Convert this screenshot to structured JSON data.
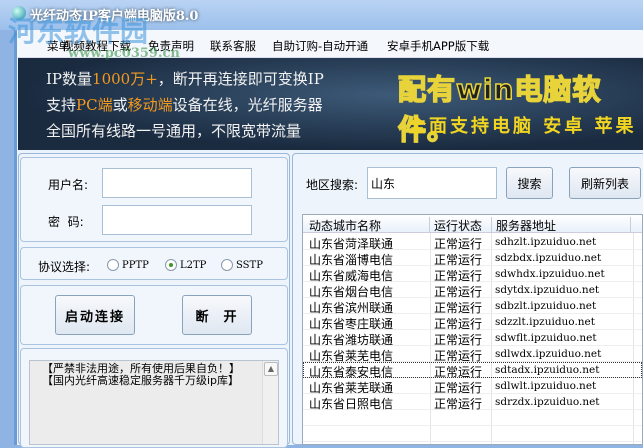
{
  "window": {
    "title": "光纤动态IP客户端电脑版8.0"
  },
  "watermark": {
    "name": "河东软件园",
    "url": "www.pc0359.cn"
  },
  "menu": [
    "菜单",
    "视频教程下载",
    "免责声明",
    "联系客服",
    "自助订购-自动开通",
    "安卓手机APP版下载"
  ],
  "banner": {
    "line1": [
      "IP数量",
      "1000万+",
      "，断开再连接即可变换IP"
    ],
    "line2": [
      "支持",
      "PC端",
      "或",
      "移动端",
      "设备在线，光纤服务器"
    ],
    "line3": "全国所有线路一号通用，不限宽带流量",
    "big": "配有win电脑软件。",
    "sub": "全面支持电脑 安卓 苹果"
  },
  "login": {
    "username_label": "用户名:",
    "username_value": "",
    "password_label": "密  码:",
    "password_value": ""
  },
  "protocol": {
    "label": "协议选择:",
    "options": [
      "PPTP",
      "L2TP",
      "SSTP"
    ],
    "selected": "L2TP"
  },
  "actions": {
    "connect": "启动连接",
    "disconnect": "断  开"
  },
  "log": [
    "【严禁非法用途，所有使用后果自负！】",
    "【国内光纤高速稳定服务器千万级ip库】"
  ],
  "search": {
    "label": "地区搜索:",
    "value": "山东",
    "search_btn": "搜索",
    "refresh_btn": "刷新列表"
  },
  "table": {
    "columns": [
      "动态城市名称",
      "运行状态",
      "服务器地址"
    ],
    "rows": [
      [
        "山东省菏泽联通",
        "正常运行",
        "sdhzlt.ipzuiduo.net"
      ],
      [
        "山东省淄博电信",
        "正常运行",
        "sdzbdx.ipzuiduo.net"
      ],
      [
        "山东省威海电信",
        "正常运行",
        "sdwhdx.ipzuiduo.net"
      ],
      [
        "山东省烟台电信",
        "正常运行",
        "sdytdx.ipzuiduo.net"
      ],
      [
        "山东省滨州联通",
        "正常运行",
        "sdbzlt.ipzuiduo.net"
      ],
      [
        "山东省枣庄联通",
        "正常运行",
        "sdzzlt.ipzuiduo.net"
      ],
      [
        "山东省潍坊联通",
        "正常运行",
        "sdwflt.ipzuiduo.net"
      ],
      [
        "山东省莱芜电信",
        "正常运行",
        "sdlwdx.ipzuiduo.net"
      ],
      [
        "山东省泰安电信",
        "正常运行",
        "sdtadx.ipzuiduo.net"
      ],
      [
        "山东省莱芜联通",
        "正常运行",
        "sdlwlt.ipzuiduo.net"
      ],
      [
        "山东省日照电信",
        "正常运行",
        "sdrzdx.ipzuiduo.net"
      ]
    ],
    "focused_row": 8
  }
}
